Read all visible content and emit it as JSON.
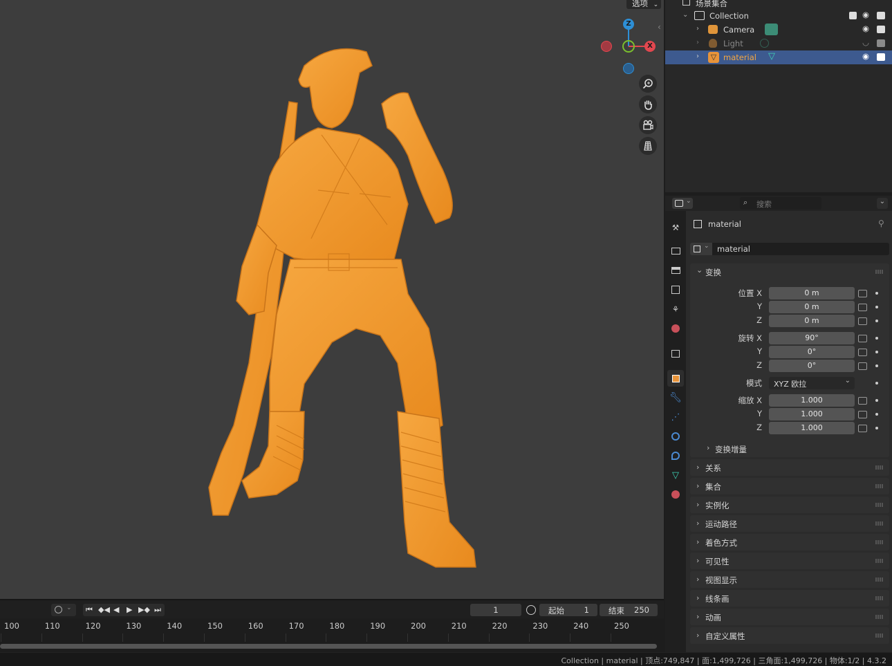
{
  "viewport": {
    "options_label": "选项",
    "gizmo": {
      "z": "Z",
      "x": "X"
    }
  },
  "timeline": {
    "current_frame": "1",
    "start_label": "起始",
    "start_value": "1",
    "end_label": "结束",
    "end_value": "250",
    "ruler": [
      "100",
      "110",
      "120",
      "130",
      "140",
      "150",
      "160",
      "170",
      "180",
      "190",
      "200",
      "210",
      "220",
      "230",
      "240",
      "250"
    ]
  },
  "outliner": {
    "scene_collection": "场景集合",
    "rows": [
      {
        "label": "Collection"
      },
      {
        "label": "Camera"
      },
      {
        "label": "Light"
      },
      {
        "label": "material"
      }
    ]
  },
  "properties": {
    "search_placeholder": "搜索",
    "object_name": "material",
    "datablock_name": "material",
    "transform": {
      "title": "变换",
      "location_label": "位置 X",
      "location": [
        "0 m",
        "0 m",
        "0 m"
      ],
      "rotation_label": "旋转 X",
      "rotation": [
        "90°",
        "0°",
        "0°"
      ],
      "y_label": "Y",
      "z_label": "Z",
      "mode_label": "模式",
      "mode_value": "XYZ 欧拉",
      "scale_label": "缩放 X",
      "scale": [
        "1.000",
        "1.000",
        "1.000"
      ],
      "delta": "变换增量"
    },
    "panels": [
      "关系",
      "集合",
      "实例化",
      "运动路径",
      "着色方式",
      "可见性",
      "视图显示",
      "线条画",
      "动画",
      "自定义属性"
    ]
  },
  "status": {
    "text": "Collection | material | 顶点:749,847 | 面:1,499,726 | 三角面:1,499,726 | 物体:1/2 | 4.3.2"
  },
  "colors": {
    "accent_orange": "#f0982f",
    "selection_blue": "#3d5a8f",
    "axis_x": "#e2474f",
    "axis_y": "#7bbf2e",
    "axis_z": "#2d8fd6"
  }
}
